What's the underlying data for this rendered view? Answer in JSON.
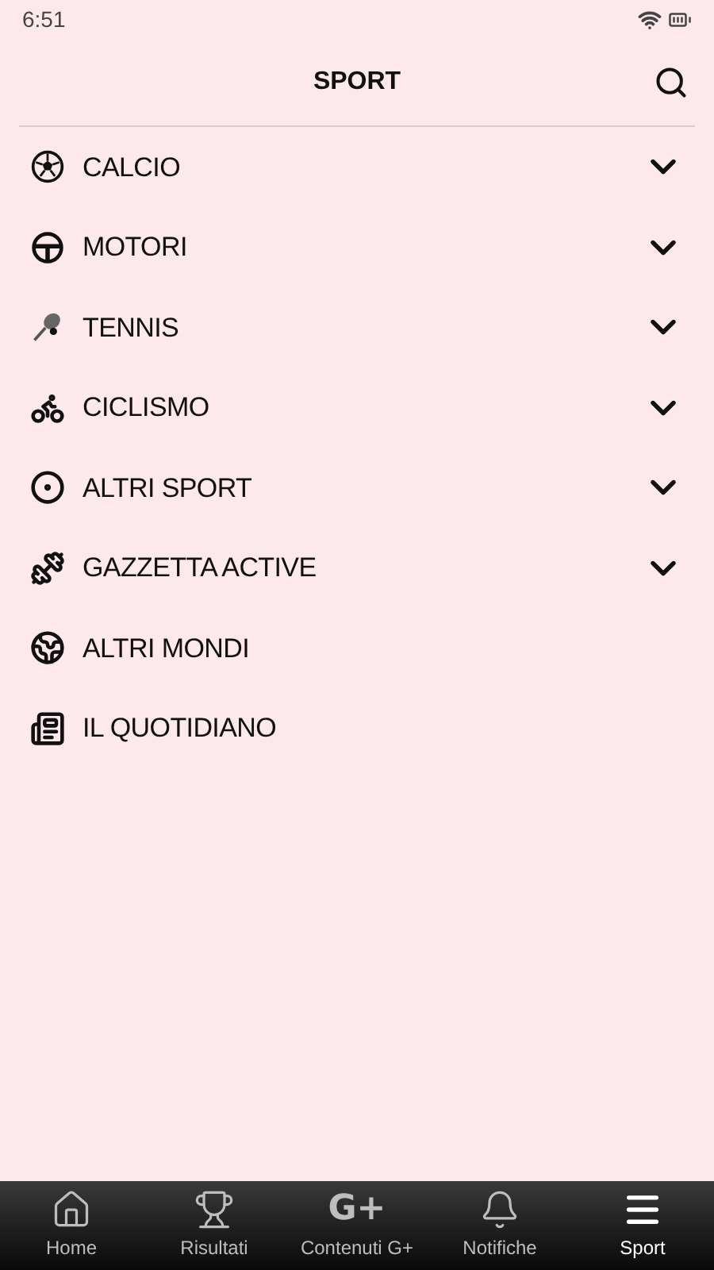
{
  "status_bar": {
    "time": "6:51"
  },
  "header": {
    "title": "SPORT"
  },
  "menu": [
    {
      "label": "CALCIO",
      "kind": "ball",
      "expandable": true
    },
    {
      "label": "MOTORI",
      "kind": "wheel",
      "expandable": true
    },
    {
      "label": "TENNIS",
      "kind": "racket",
      "expandable": true
    },
    {
      "label": "CICLISMO",
      "kind": "bike",
      "expandable": true
    },
    {
      "label": "ALTRI SPORT",
      "kind": "target",
      "expandable": true
    },
    {
      "label": "GAZZETTA ACTIVE",
      "kind": "dumbbell",
      "expandable": true
    },
    {
      "label": "ALTRI MONDI",
      "kind": "globe",
      "expandable": false
    },
    {
      "label": "IL QUOTIDIANO",
      "kind": "newspaper",
      "expandable": false
    }
  ],
  "bottom_nav": [
    {
      "label": "Home",
      "kind": "home",
      "selected": false
    },
    {
      "label": "Risultati",
      "kind": "trophy",
      "selected": false
    },
    {
      "label": "Contenuti G+",
      "kind": "gplus",
      "glyph": "G+",
      "selected": false
    },
    {
      "label": "Notifiche",
      "kind": "bell",
      "selected": false
    },
    {
      "label": "Sport",
      "kind": "menu",
      "selected": true
    }
  ]
}
